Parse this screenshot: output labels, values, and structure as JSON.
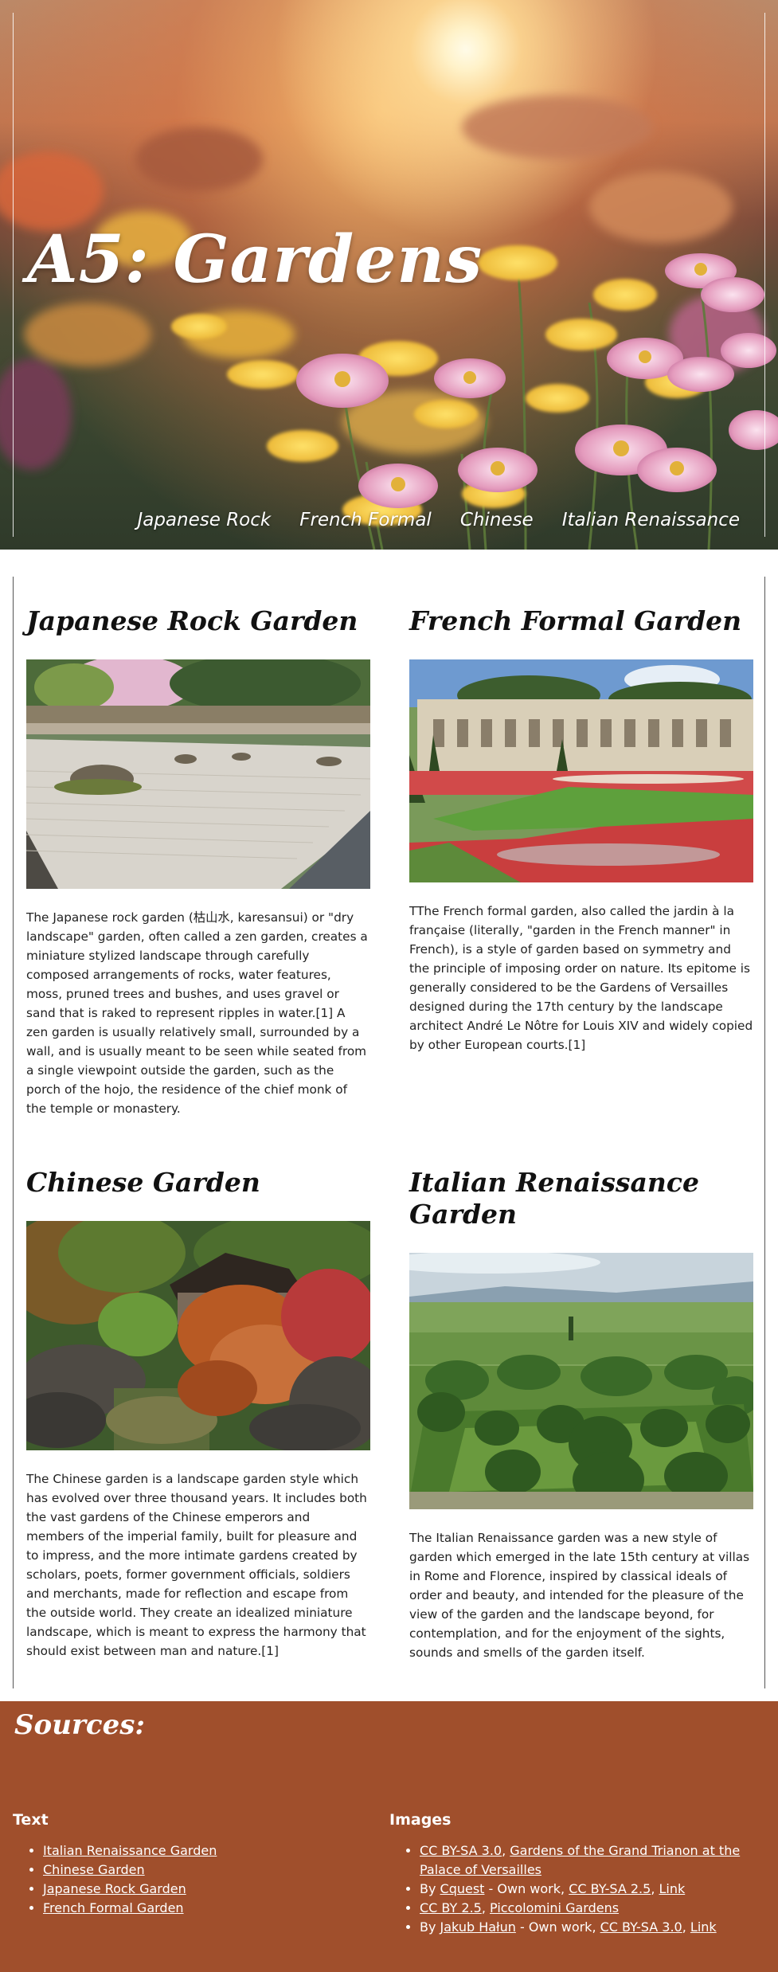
{
  "hero": {
    "title": "A5: Gardens",
    "nav": [
      "Japanese Rock",
      "French Formal",
      "Chinese",
      "Italian Renaissance"
    ]
  },
  "gardens": [
    {
      "title": "Japanese Rock Garden",
      "image_alt": "Japanese rock garden photo",
      "text": "The Japanese rock garden (枯山水, karesansui) or \"dry landscape\" garden, often called a zen garden, creates a miniature stylized landscape through carefully composed arrangements of rocks, water features, moss, pruned trees and bushes, and uses gravel or sand that is raked to represent ripples in water.[1] A zen garden is usually relatively small, surrounded by a wall, and is usually meant to be seen while seated from a single viewpoint outside the garden, such as the porch of the hojo, the residence of the chief monk of the temple or monastery."
    },
    {
      "title": "French Formal Garden",
      "image_alt": "French formal garden photo",
      "text": "TThe French formal garden, also called the jardin à la française (literally, \"garden in the French manner\" in French), is a style of garden based on symmetry and the principle of imposing order on nature. Its epitome is generally considered to be the Gardens of Versailles designed during the 17th century by the landscape architect André Le Nôtre for Louis XIV and widely copied by other European courts.[1]"
    },
    {
      "title": "Chinese Garden",
      "image_alt": "Chinese garden photo",
      "text": "The Chinese garden is a landscape garden style which has evolved over three thousand years. It includes both the vast gardens of the Chinese emperors and members of the imperial family, built for pleasure and to impress, and the more intimate gardens created by scholars, poets, former government officials, soldiers and merchants, made for reflection and escape from the outside world. They create an idealized miniature landscape, which is meant to express the harmony that should exist between man and nature.[1]"
    },
    {
      "title": "Italian Renaissance Garden",
      "image_alt": "Italian Renaissance garden photo",
      "text": "The Italian Renaissance garden was a new style of garden which emerged in the late 15th century at villas in Rome and Florence, inspired by classical ideals of order and beauty, and intended for the pleasure of the view of the garden and the landscape beyond, for contemplation, and for the enjoyment of the sights, sounds and smells of the garden itself."
    }
  ],
  "sources": {
    "title": "Sources:",
    "text_heading": "Text",
    "text_links": [
      "Italian Renaissance Garden",
      "Chinese Garden",
      "Japanese Rock Garden",
      "French Formal Garden"
    ],
    "images_heading": "Images",
    "image_credits": {
      "item1": {
        "link_a": "CC BY-SA 3.0",
        "sep": ", ",
        "link_b": "Gardens of the Grand Trianon at the Palace of Versailles"
      },
      "item2": {
        "prefix": "By ",
        "author": "Cquest",
        "middle": " - Own work, ",
        "license": "CC BY-SA 2.5",
        "sep": ", ",
        "link": "Link"
      },
      "item3": {
        "license": "CC BY 2.5",
        "sep": ", ",
        "link": "Piccolomini Gardens"
      },
      "item4": {
        "prefix": "By ",
        "author": "Jakub Hałun",
        "middle": " - Own work, ",
        "license": "CC BY-SA 3.0",
        "sep": ", ",
        "link": "Link"
      }
    }
  },
  "colors": {
    "sources_bg": "#a04f2c",
    "hero_text": "#ffffff"
  }
}
